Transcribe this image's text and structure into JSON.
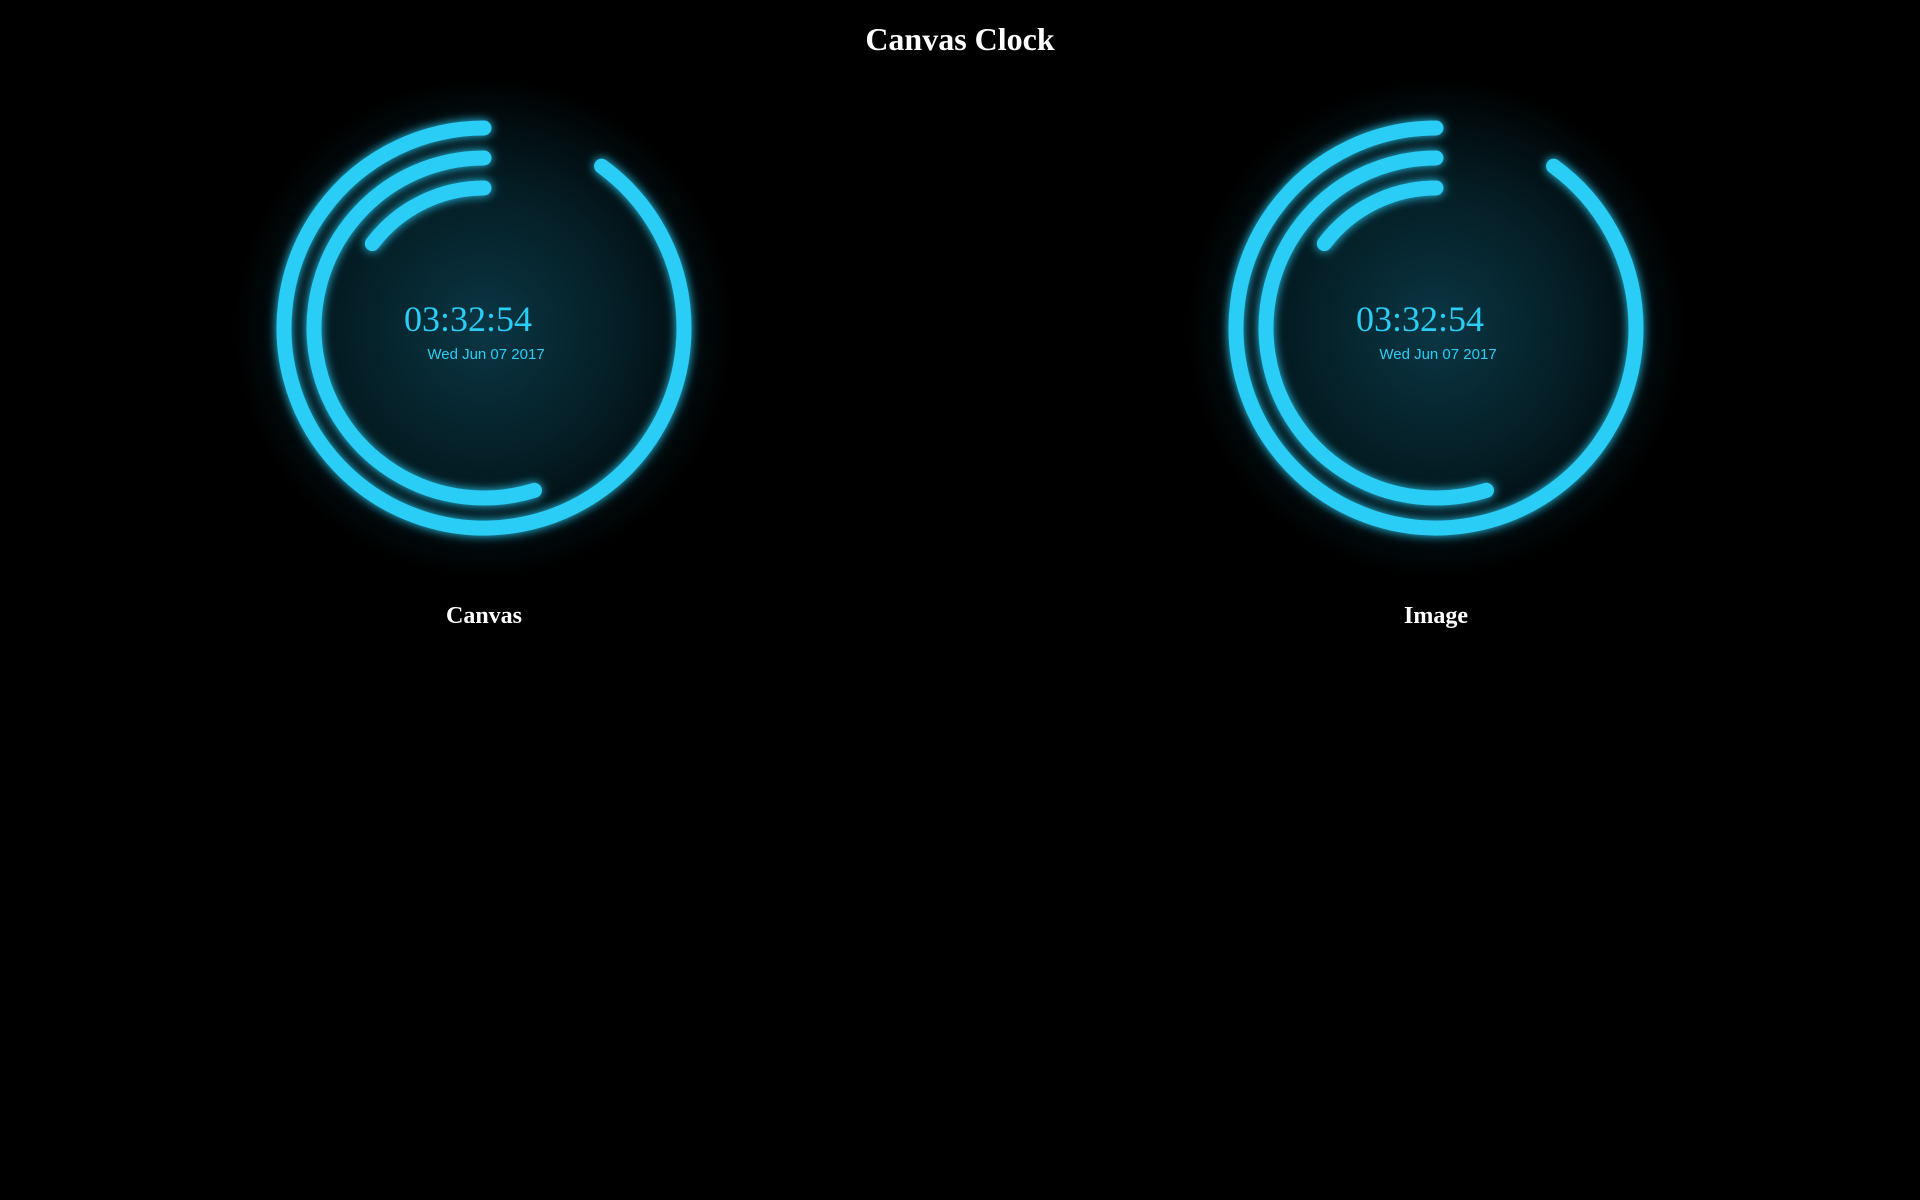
{
  "page": {
    "title": "Canvas Clock"
  },
  "theme": {
    "background": "#000000",
    "accent": "#29cdf5",
    "text": "#ffffff"
  },
  "clocks": [
    {
      "label": "Canvas",
      "time": "03:32:54",
      "date": "Wed Jun 07 2017",
      "arcs": {
        "hours": 0.147,
        "minutes": 0.548,
        "seconds": 0.9
      }
    },
    {
      "label": "Image",
      "time": "03:32:54",
      "date": "Wed Jun 07 2017",
      "arcs": {
        "hours": 0.147,
        "minutes": 0.548,
        "seconds": 0.9
      }
    }
  ]
}
